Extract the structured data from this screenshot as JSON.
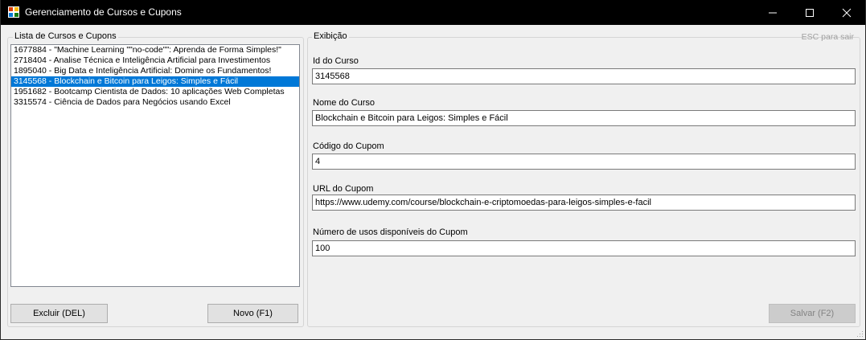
{
  "window": {
    "title": "Gerenciamento de Cursos e Cupons"
  },
  "list_group": {
    "legend": "Lista de Cursos e Cupons",
    "items": [
      "1677884 - \"Machine Learning \"\"no-code\"\": Aprenda de Forma Simples!\"",
      "2718404 - Analise Técnica e Inteligência Artificial para Investimentos",
      "1895040 - Big Data e Inteligência Artificial: Domine os Fundamentos!",
      "3145568 - Blockchain e Bitcoin para Leigos: Simples e Fácil",
      "1951682 - Bootcamp Cientista de Dados: 10 aplicações Web Completas",
      "3315574 - Ciência de Dados para Negócios usando Excel"
    ],
    "selected_index": 3,
    "delete_label": "Excluir (DEL)",
    "new_label": "Novo (F1)"
  },
  "display_group": {
    "legend": "Exibição",
    "esc_hint": "ESC para sair",
    "course_id_label": "Id do Curso",
    "course_id_value": "3145568",
    "course_name_label": "Nome do Curso",
    "course_name_value": "Blockchain e Bitcoin para Leigos: Simples e Fácil",
    "coupon_code_label": "Código do Cupom",
    "coupon_code_value": "4",
    "coupon_url_label": "URL do Cupom",
    "coupon_url_value": "https://www.udemy.com/course/blockchain-e-criptomoedas-para-leigos-simples-e-facil",
    "uses_label": "Número de usos disponíveis do Cupom",
    "uses_value": "100",
    "save_label": "Salvar (F2)"
  },
  "colors": {
    "titlebar": "#000000",
    "selection": "#0078d7",
    "window_bg": "#f0f0f0"
  },
  "icons": [
    "app-icon",
    "minimize-icon",
    "maximize-icon",
    "close-icon",
    "resize-grip-icon"
  ]
}
